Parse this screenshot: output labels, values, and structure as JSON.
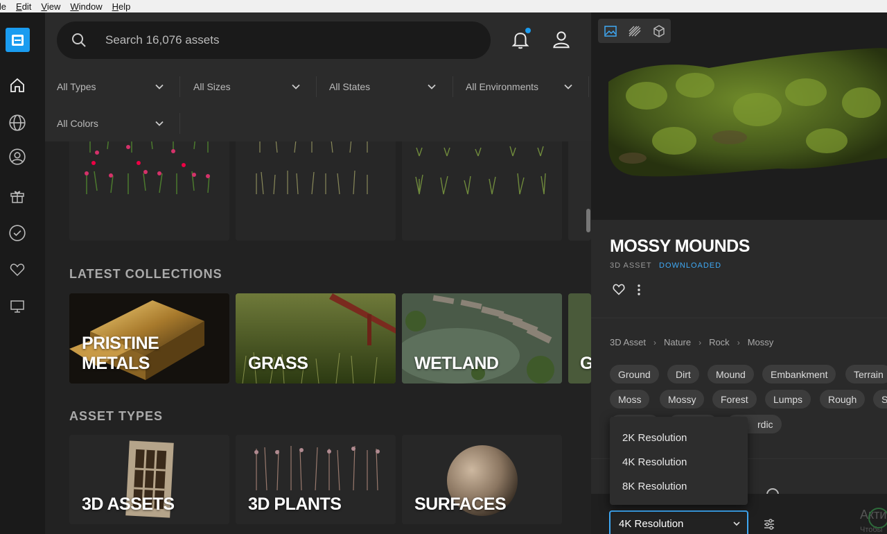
{
  "menubar": {
    "items": [
      "ile",
      "Edit",
      "View",
      "Window",
      "Help"
    ]
  },
  "sidebar": {
    "icons": [
      "home-icon",
      "globe-icon",
      "user-circle-icon",
      "gift-icon",
      "check-circle-icon",
      "heart-icon",
      "monitor-icon"
    ]
  },
  "search": {
    "placeholder": "Search 16,076 assets"
  },
  "filters": [
    "All Types",
    "All Sizes",
    "All States",
    "All Environments",
    "All Colors"
  ],
  "sections": {
    "latest_collections": "LATEST COLLECTIONS",
    "asset_types": "ASSET TYPES"
  },
  "collections": [
    "PRISTINE METALS",
    "GRASS",
    "WETLAND",
    "G"
  ],
  "asset_types": [
    "3D ASSETS",
    "3D PLANTS",
    "SURFACES"
  ],
  "detail": {
    "title": "MOSSY MOUNDS",
    "type": "3D ASSET",
    "status": "DOWNLOADED",
    "breadcrumb": [
      "3D Asset",
      "Nature",
      "Rock",
      "Mossy"
    ],
    "tags_row1": [
      "Ground",
      "Dirt",
      "Mound",
      "Embankment",
      "Terrain"
    ],
    "tags_row2": [
      "Moss",
      "Mossy",
      "Forest",
      "Lumps",
      "Rough",
      "S"
    ],
    "tags_row3_partial": "rdic",
    "resolution_options": [
      "2K Resolution",
      "4K Resolution",
      "8K Resolution"
    ],
    "selected_resolution": "4K Resolution",
    "watermark": "Акти",
    "watermark2": "Чтобы"
  },
  "colors": {
    "accent": "#1a9cf0",
    "status": "#3fa9f5"
  }
}
